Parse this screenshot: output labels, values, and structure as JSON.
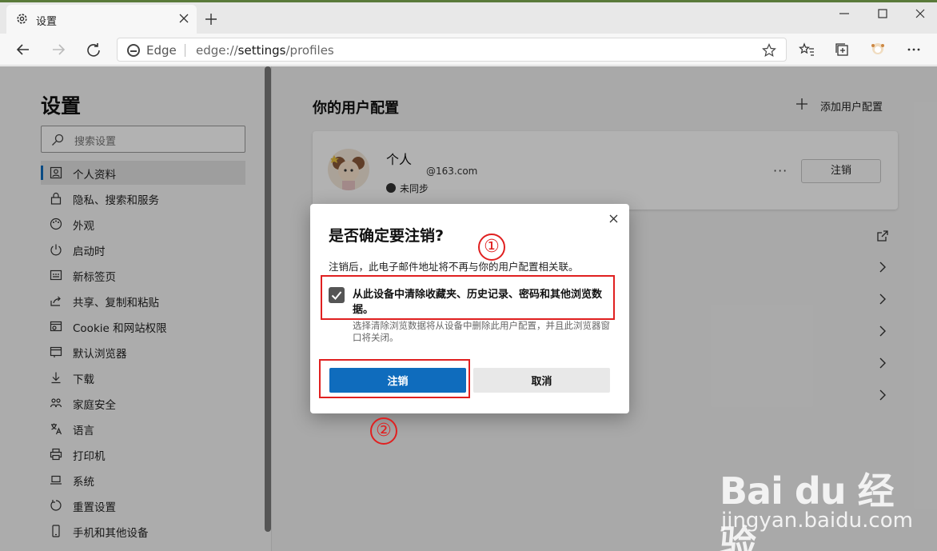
{
  "tab": {
    "title": "设置"
  },
  "address": {
    "edge_label": "Edge",
    "url_prefix": "edge://",
    "url_path": "settings",
    "url_suffix": "/profiles"
  },
  "sidebar": {
    "title": "设置",
    "search_placeholder": "搜索设置",
    "items": [
      {
        "label": "个人资料",
        "icon": "profile-icon"
      },
      {
        "label": "隐私、搜索和服务",
        "icon": "lock-icon"
      },
      {
        "label": "外观",
        "icon": "palette-icon"
      },
      {
        "label": "启动时",
        "icon": "power-icon"
      },
      {
        "label": "新标签页",
        "icon": "newtab-icon"
      },
      {
        "label": "共享、复制和粘贴",
        "icon": "share-icon"
      },
      {
        "label": "Cookie 和网站权限",
        "icon": "cookie-icon"
      },
      {
        "label": "默认浏览器",
        "icon": "browser-icon"
      },
      {
        "label": "下载",
        "icon": "download-icon"
      },
      {
        "label": "家庭安全",
        "icon": "family-icon"
      },
      {
        "label": "语言",
        "icon": "language-icon"
      },
      {
        "label": "打印机",
        "icon": "printer-icon"
      },
      {
        "label": "系统",
        "icon": "laptop-icon"
      },
      {
        "label": "重置设置",
        "icon": "reset-icon"
      },
      {
        "label": "手机和其他设备",
        "icon": "phone-icon"
      }
    ]
  },
  "main": {
    "title": "你的用户配置",
    "add_profile": "添加用户配置",
    "profile": {
      "name": "个人",
      "email": "@163.com",
      "sync": "未同步",
      "more": "···",
      "signout": "注销"
    }
  },
  "dialog": {
    "title": "是否确定要注销?",
    "description": "注销后，此电子邮件地址将不再与你的用户配置相关联。",
    "checkbox_label": "从此设备中清除收藏夹、历史记录、密码和其他浏览数据。",
    "checkbox_checked": true,
    "hint": "选择清除浏览数据将从设备中删除此用户配置，并且此浏览器窗口将关闭。",
    "confirm": "注销",
    "cancel": "取消"
  },
  "annotations": {
    "one": "①",
    "two": "②"
  },
  "watermark": {
    "logo": "Bai du 经验",
    "url": "jingyan.baidu.com"
  },
  "colors": {
    "accent": "#0f6cbd",
    "annotation": "#e02020"
  }
}
